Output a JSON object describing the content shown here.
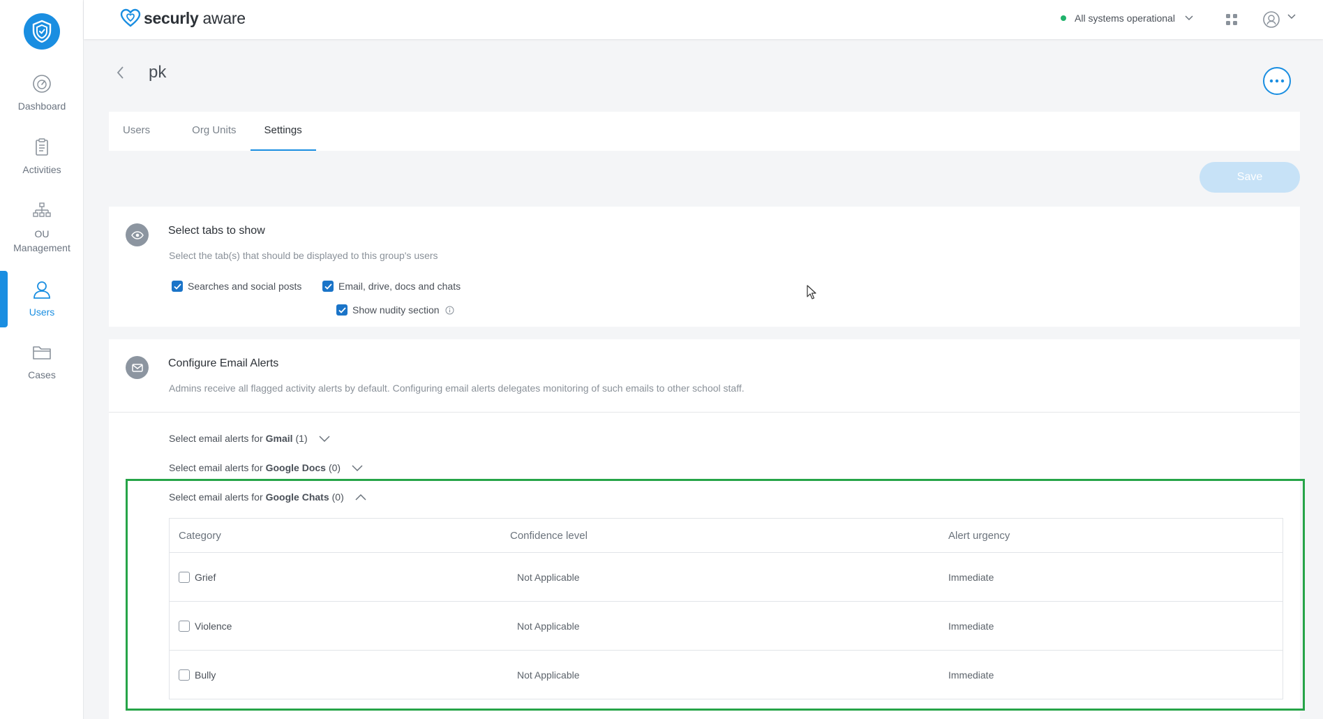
{
  "brand": {
    "name_bold": "securly",
    "name_light": " aware"
  },
  "header": {
    "status_text": "All systems operational",
    "status_color": "#20b26b"
  },
  "sidebar": {
    "items": [
      {
        "label": "Dashboard",
        "icon": "dashboard-gauge-icon"
      },
      {
        "label": "Activities",
        "icon": "clipboard-icon"
      },
      {
        "label": "OU\nManagement",
        "label_line1": "OU",
        "label_line2": "Management",
        "icon": "org-tree-icon"
      },
      {
        "label": "Users",
        "icon": "user-icon",
        "active": true
      },
      {
        "label": "Cases",
        "icon": "folder-icon"
      }
    ]
  },
  "page": {
    "title": "pk"
  },
  "tabs": [
    {
      "label": "Users"
    },
    {
      "label": "Org Units"
    },
    {
      "label": "Settings",
      "active": true
    }
  ],
  "toolbar": {
    "save_label": "Save"
  },
  "tabs_section": {
    "title": "Select tabs to show",
    "description": "Select the tab(s) that should be displayed to this group's users",
    "options": [
      {
        "label": "Searches and social posts",
        "checked": true
      },
      {
        "label": "Email, drive, docs and chats",
        "checked": true
      },
      {
        "label": "Show nudity section",
        "checked": true
      }
    ]
  },
  "email_section": {
    "title": "Configure Email Alerts",
    "description": "Admins receive all flagged activity alerts by default. Configuring email alerts delegates monitoring of such emails to other school staff.",
    "accordions": [
      {
        "prefix": "Select email alerts for",
        "service": "Gmail",
        "count": "(1)",
        "expanded": false
      },
      {
        "prefix": "Select email alerts for",
        "service": "Google Docs",
        "count": "(0)",
        "expanded": false
      },
      {
        "prefix": "Select email alerts for",
        "service": "Google Chats",
        "count": "(0)",
        "expanded": true
      }
    ],
    "table": {
      "headers": [
        "Category",
        "Confidence level",
        "Alert urgency"
      ],
      "rows": [
        {
          "category": "Grief",
          "confidence": "Not Applicable",
          "urgency": "Immediate",
          "checked": false
        },
        {
          "category": "Violence",
          "confidence": "Not Applicable",
          "urgency": "Immediate",
          "checked": false
        },
        {
          "category": "Bully",
          "confidence": "Not Applicable",
          "urgency": "Immediate",
          "checked": false
        }
      ]
    }
  },
  "colors": {
    "accent": "#1a8ee1",
    "highlight": "#26a448",
    "save_disabled": "#c7e2f7"
  }
}
